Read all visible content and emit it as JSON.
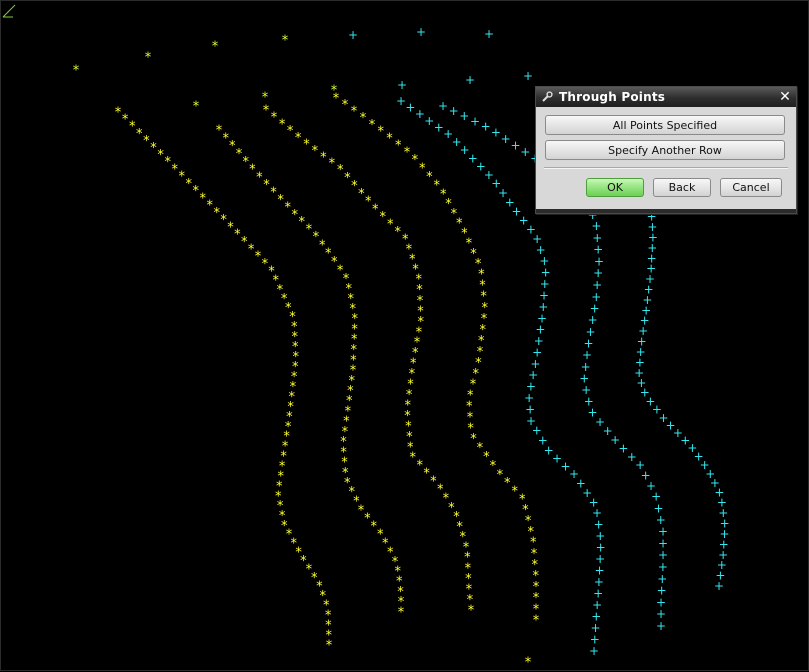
{
  "colors": {
    "background": "#000000",
    "yellow_points": "#ffff33",
    "yellowgreen_points": "#d8ff3a",
    "cyan_points": "#33e8f0",
    "ok_button": "#8fe27a"
  },
  "icons": {
    "title_icon": "wrench-icon",
    "close_icon": "close-icon",
    "axis_icon": "axis-triad-icon"
  },
  "dialog": {
    "title": "Through Points",
    "close_label": "✕",
    "buttons": {
      "all_points": "All Points Specified",
      "another_row": "Specify Another Row",
      "ok": "OK",
      "back": "Back",
      "cancel": "Cancel"
    }
  }
}
